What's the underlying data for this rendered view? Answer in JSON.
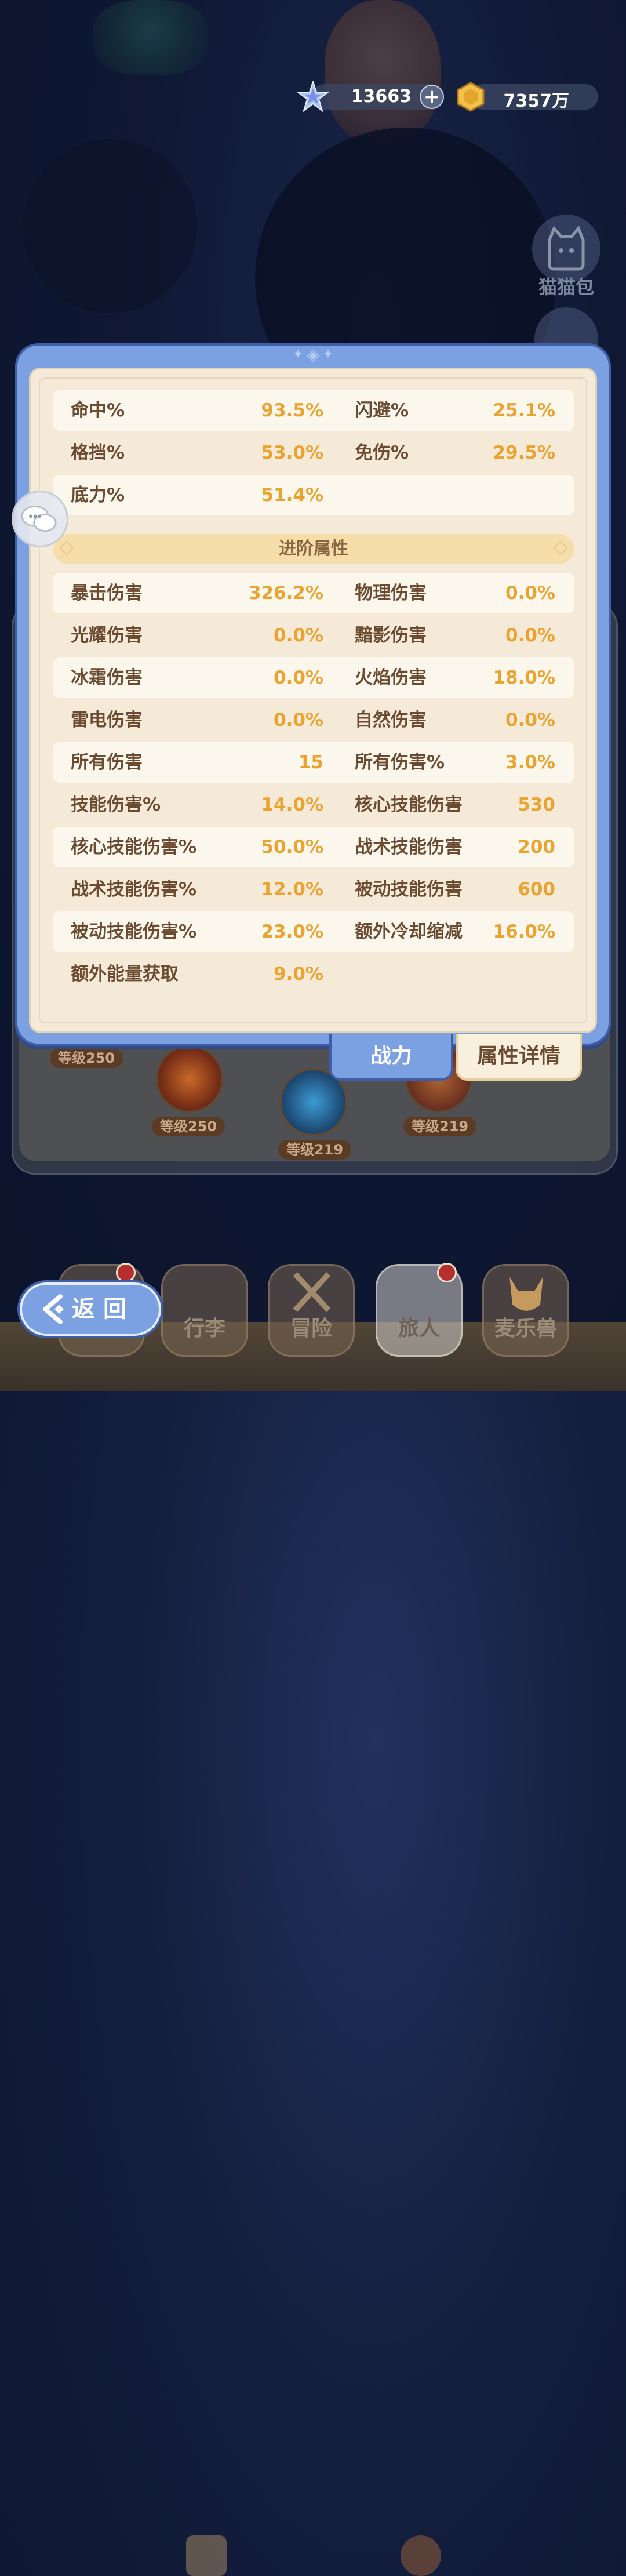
{
  "currency": {
    "crystal_icon": "crystal-star-icon",
    "crystal_value": "13663",
    "plus_label": "+",
    "coin_icon": "gold-coin-icon",
    "coin_value": "7357万"
  },
  "side": {
    "cat_bag_label": "猫猫包"
  },
  "basic_stats": [
    {
      "label1": "命中%",
      "value1": "93.5%",
      "label2": "闪避%",
      "value2": "25.1%"
    },
    {
      "label1": "格挡%",
      "value1": "53.0%",
      "label2": "免伤%",
      "value2": "29.5%"
    },
    {
      "label1": "底力%",
      "value1": "51.4%",
      "label2": "",
      "value2": ""
    }
  ],
  "advanced_section_title": "进阶属性",
  "advanced_stats": [
    {
      "label1": "暴击伤害",
      "value1": "326.2%",
      "label2": "物理伤害",
      "value2": "0.0%"
    },
    {
      "label1": "光耀伤害",
      "value1": "0.0%",
      "label2": "黯影伤害",
      "value2": "0.0%"
    },
    {
      "label1": "冰霜伤害",
      "value1": "0.0%",
      "label2": "火焰伤害",
      "value2": "18.0%"
    },
    {
      "label1": "雷电伤害",
      "value1": "0.0%",
      "label2": "自然伤害",
      "value2": "0.0%"
    },
    {
      "label1": "所有伤害",
      "value1": "15",
      "label2": "所有伤害%",
      "value2": "3.0%"
    },
    {
      "label1": "技能伤害%",
      "value1": "14.0%",
      "label2": "核心技能伤害",
      "value2": "530"
    },
    {
      "label1": "核心技能伤害%",
      "value1": "50.0%",
      "label2": "战术技能伤害",
      "value2": "200"
    },
    {
      "label1": "战术技能伤害%",
      "value1": "12.0%",
      "label2": "被动技能伤害",
      "value2": "600"
    },
    {
      "label1": "被动技能伤害%",
      "value1": "23.0%",
      "label2": "额外冷却缩减",
      "value2": "16.0%"
    },
    {
      "label1": "额外能量获取",
      "value1": "9.0%",
      "label2": "",
      "value2": ""
    }
  ],
  "tabs": {
    "power": "战力",
    "detail": "属性详情"
  },
  "levels": {
    "a": "等级250",
    "b": "等级250",
    "c": "等级219",
    "d": "等级219"
  },
  "back_label": "返回",
  "nav": {
    "luggage": "行李",
    "adventure": "冒险",
    "traveler": "旅人",
    "beast": "麦乐兽"
  },
  "colors": {
    "panel_blue": "#7ca1e2",
    "stat_value": "#eba330",
    "stat_label": "#6b4c33",
    "panel_bg": "#f4ead7"
  }
}
